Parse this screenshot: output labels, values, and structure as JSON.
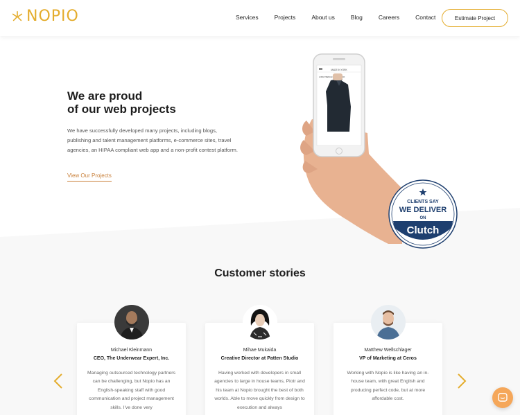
{
  "header": {
    "logo_text": "NOPIO",
    "nav": [
      "Services",
      "Projects",
      "About us",
      "Blog",
      "Careers",
      "Contact"
    ],
    "cta_label": "Estimate Project"
  },
  "hero": {
    "title_line1": "We are proud",
    "title_line2": "of our web projects",
    "text": "We have successfully developed many projects, including blogs, publishing and talent management platforms, e-commerce sites, travel agencies, an HIPAA compliant web app and a non-profit contest platform.",
    "link_label": "View Our Projects",
    "phone_screen": {
      "store_name": "MADE IN YORK",
      "product_title": "LONG TRENCH COAT - BLACK"
    }
  },
  "badge": {
    "line1": "CLIENTS SAY",
    "line2": "WE DELIVER",
    "line3": "ON",
    "brand": "Clutch"
  },
  "stories": {
    "title": "Customer stories",
    "cards": [
      {
        "name": "Michael Kleinmann",
        "role": "CEO, The Underwear Expert, Inc.",
        "quote": "Managing outsourced technology partners can be challenging, but Nopio has an English-speaking staff with good communication and project management skills. I've done very"
      },
      {
        "name": "Mihae Mukaida",
        "role": "Creative Director at Patten Studio",
        "quote": "Having worked with developers in small agencies to large in house teams, Piotr and his team at Nopio brought the best of both worlds. Able to move quickly from design to execution and always"
      },
      {
        "name": "Matthew Wellschlager",
        "role": "VP of Marketing at Ceros",
        "quote": "Working with Nopio is like having an in-house team, with great English and producing perfect code, but at more affordable cost."
      }
    ]
  },
  "colors": {
    "accent": "#e4ad2e",
    "link": "#c9803a",
    "badge_navy": "#1e3f6f",
    "chat": "#f5a75a"
  },
  "icons": {
    "logo": "asterisk-logo-icon",
    "prev": "chevron-left-icon",
    "next": "chevron-right-icon",
    "chat": "chat-bubble-icon"
  }
}
